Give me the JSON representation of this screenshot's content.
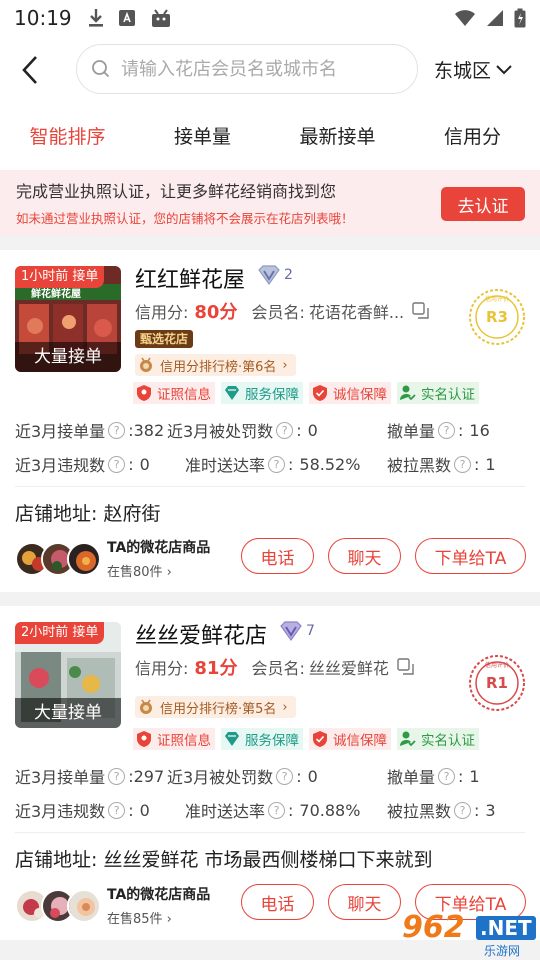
{
  "status_bar": {
    "time": "10:19"
  },
  "header": {
    "search_placeholder": "请输入花店会员名或城市名",
    "city": "东城区"
  },
  "tabs": [
    {
      "label": "智能排序",
      "active": true
    },
    {
      "label": "接单量",
      "active": false
    },
    {
      "label": "最新接单",
      "active": false
    },
    {
      "label": "信用分",
      "active": false
    }
  ],
  "banner": {
    "title": "完成营业执照认证，让更多鲜花经销商找到您",
    "subtitle": "如未通过营业执照认证，您的店铺将不会展示在花店列表哦！",
    "button": "去认证"
  },
  "labels": {
    "bulk": "大量接单",
    "credit": "信用分:",
    "member": "会员名:",
    "verify": "证照信息",
    "service": "服务保障",
    "honest": "诚信保障",
    "realname": "实名认证",
    "orders3m": "近3月接单量",
    "penalty3m": "近3月被处罚数",
    "cancel": "撤单量",
    "violation3m": "近3月违规数",
    "ontime": "准时送达率",
    "blacklist": "被拉黑数",
    "address": "店铺地址:",
    "micro_title": "TA的微花店商品",
    "call": "电话",
    "chat": "聊天",
    "order_to": "下单给TA",
    "select_tag": "甄选花店",
    "colon": ":"
  },
  "shops": [
    {
      "time_tag": "1小时前 接单",
      "name": "红红鲜花屋",
      "level": "2",
      "credit_score": "80分",
      "member_name": "花语花香鲜...",
      "seal_text": "R3",
      "seal_top": "信用评价",
      "rank": "信用分排行榜·第6名",
      "orders": "382",
      "penalty": "0",
      "cancel": "16",
      "violation": "0",
      "ontime": "58.52%",
      "blacklist": "1",
      "address": "赵府街",
      "on_sale": "在售80件",
      "thumb_sign": "鲜花鲜花屋"
    },
    {
      "time_tag": "2小时前 接单",
      "name": "丝丝爱鲜花店",
      "level": "7",
      "credit_score": "81分",
      "member_name": "丝丝爱鲜花",
      "seal_text": "R1",
      "seal_top": "信用评价",
      "rank": "信用分排行榜·第5名",
      "orders": "297",
      "penalty": "0",
      "cancel": "1",
      "violation": "0",
      "ontime": "70.88%",
      "blacklist": "3",
      "address": "丝丝爱鲜花 市场最西侧楼梯口下来就到",
      "on_sale": "在售85件",
      "thumb_sign": ""
    }
  ],
  "watermark": {
    "num": "962",
    "net": ".NET",
    "cn": "乐游网"
  },
  "colors": {
    "accent": "#e8443a",
    "banner_bg": "#fdeced"
  }
}
